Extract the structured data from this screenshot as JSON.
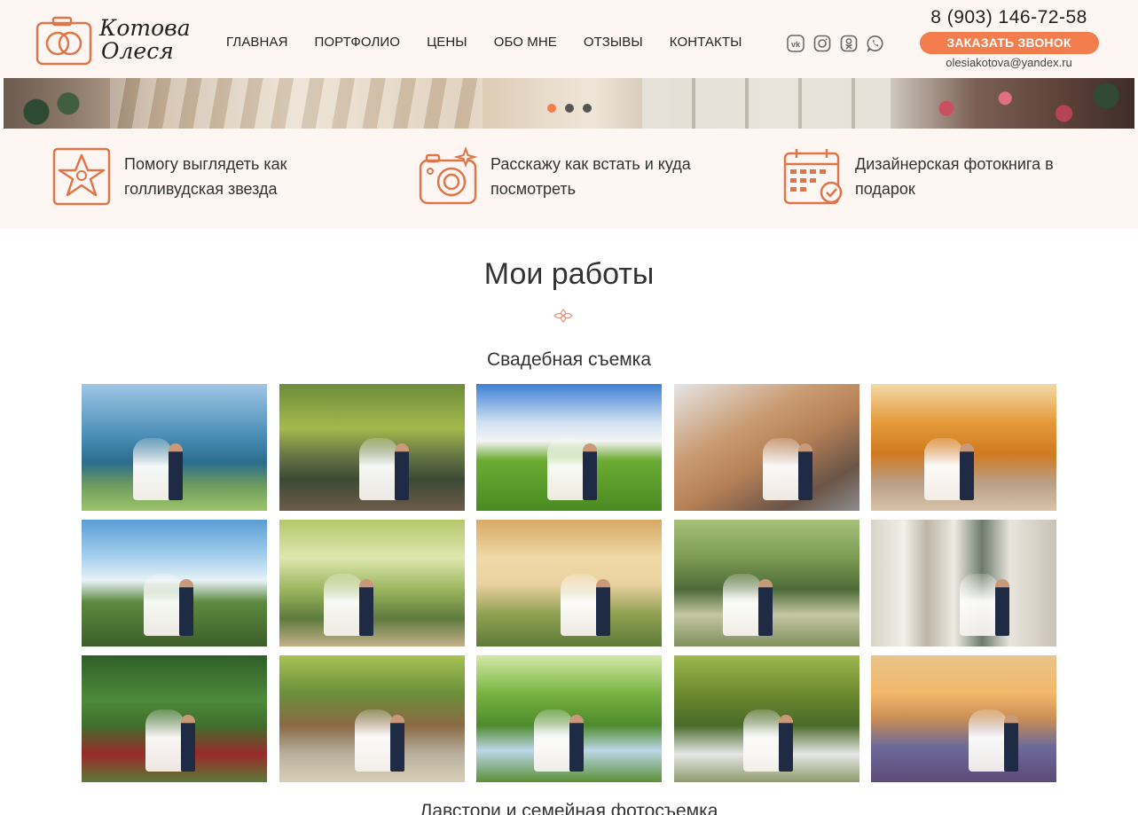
{
  "header": {
    "logo": {
      "line1": "Котова",
      "line2": "Олеся"
    },
    "nav": [
      "ГЛАВНАЯ",
      "ПОРТФОЛИО",
      "ЦЕНЫ",
      "ОБО МНЕ",
      "ОТЗЫВЫ",
      "КОНТАКТЫ"
    ],
    "socials": [
      "vk-icon",
      "instagram-icon",
      "odnoklassniki-icon",
      "whatsapp-icon"
    ],
    "phone": "8 (903) 146-72-58",
    "call_button": "ЗАКАЗАТЬ ЗВОНОК",
    "email": "olesiakotova@yandex.ru"
  },
  "slider": {
    "slides": 3,
    "active": 1
  },
  "features": [
    {
      "icon": "star-frame-icon",
      "text": "Помогу выглядеть как голливудская звезда"
    },
    {
      "icon": "camera-icon",
      "text": "Расскажу как встать и куда посмотреть"
    },
    {
      "icon": "calendar-icon",
      "text": "Дизайнерская фотокнига в подарок"
    }
  ],
  "section": {
    "title": "Мои работы",
    "subtitle": "Свадебная съемка",
    "next_title": "Лавстори и семейная фотосъемка"
  },
  "gallery": [
    {
      "bg": "linear-gradient(180deg,#9fc6e6 0%,#4c8fb8 40%,#2b6d8d 62%,#6e9c5e 80%,#9cc36c 100%)"
    },
    {
      "bg": "linear-gradient(180deg,#6d8c3a 0%,#a5b84c 35%,#6a7a45 55%,#3b4a35 75%,#6d5b4a 100%)"
    },
    {
      "bg": "linear-gradient(180deg,#3d7fd4 0%,#cfe0f2 30%,#f4f4f4 45%,#6cac33 60%,#4a8a22 100%)"
    },
    {
      "bg": "linear-gradient(150deg,#e5e5e5 0%,#c99b72 35%,#b78157 55%,#6a5447 80%,#8c8c8c 100%)"
    },
    {
      "bg": "linear-gradient(180deg,#f3d9a8 0%,#e59b3b 30%,#d07a20 55%,#b99e88 78%,#d8c3aa 100%)"
    },
    {
      "bg": "linear-gradient(180deg,#5a9ed6 0%,#a8d1ee 30%,#e8f2f6 48%,#5d8a3f 65%,#3d5e2b 100%)"
    },
    {
      "bg": "linear-gradient(180deg,#b4c76a 0%,#dfe7b0 30%,#9ab65d 55%,#5e7a3d 78%,#c4b089 100%)"
    },
    {
      "bg": "linear-gradient(180deg,#d7a964 0%,#efd9a6 30%,#ecd2a2 50%,#8fa050 75%,#5d7a39 100%)"
    },
    {
      "bg": "linear-gradient(180deg,#a7c27a 0%,#7c9a52 30%,#4e6a39 55%,#c4c7a3 75%,#7f8f5d 100%)"
    },
    {
      "bg": "linear-gradient(90deg,#d9d4c8 0%,#f2efe9 18%,#bdb6a6 30%,#eeeae1 45%,#6d7b6c 60%,#e9e5dd 75%,#c9c2b5 100%)"
    },
    {
      "bg": "linear-gradient(180deg,#2f5e2a 0%,#4f8a3a 35%,#3f6f2e 55%,#9a2a2a 78%,#5a7a38 100%)"
    },
    {
      "bg": "linear-gradient(180deg,#a7c254 0%,#6a8f3a 30%,#8a6a44 55%,#b8b09e 78%,#d9cfb8 100%)"
    },
    {
      "bg": "linear-gradient(180deg,#d3e9a8 0%,#79b340 30%,#4e8a2c 55%,#bcd6e8 75%,#5a8f37 100%)"
    },
    {
      "bg": "linear-gradient(180deg,#9fb84e 0%,#6c8a2e 30%,#4a6a2a 55%,#e6e6e6 78%,#8d9a6a 100%)"
    },
    {
      "bg": "linear-gradient(180deg,#e9c58a 0%,#f3b76a 30%,#c88e55 50%,#6c6a9a 72%,#5d4a78 100%)"
    }
  ]
}
